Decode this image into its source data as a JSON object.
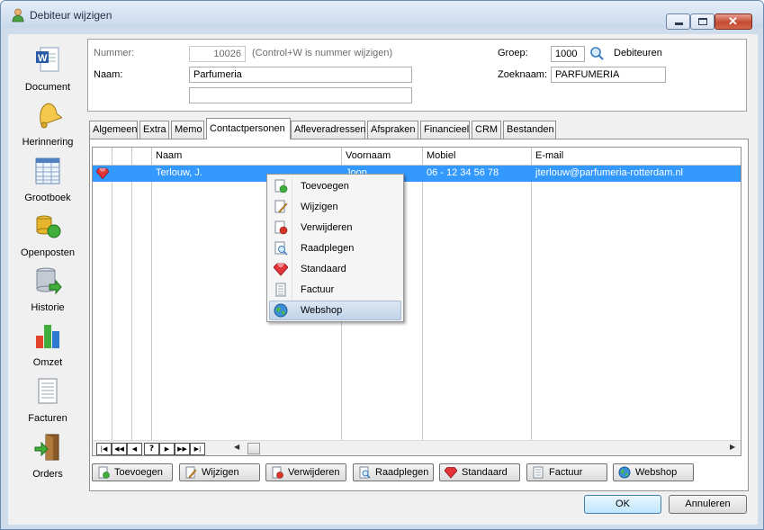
{
  "window": {
    "title": "Debiteur wijzigen"
  },
  "nav": {
    "items": [
      {
        "label": "Document",
        "icon": "word-document-icon"
      },
      {
        "label": "Herinnering",
        "icon": "bell-icon"
      },
      {
        "label": "Grootboek",
        "icon": "ledger-icon"
      },
      {
        "label": "Openposten",
        "icon": "coins-icon"
      },
      {
        "label": "Historie",
        "icon": "database-icon"
      },
      {
        "label": "Omzet",
        "icon": "bar-chart-icon"
      },
      {
        "label": "Facturen",
        "icon": "invoice-icon"
      },
      {
        "label": "Orders",
        "icon": "exit-door-icon"
      }
    ]
  },
  "header": {
    "nummer_label": "Nummer:",
    "nummer_value": "10026",
    "nummer_hint": "(Control+W is nummer wijzigen)",
    "naam_label": "Naam:",
    "naam_value": "Parfumeria",
    "naam2_value": "",
    "groep_label": "Groep:",
    "groep_value": "1000",
    "groep_name": "Debiteuren",
    "zoeknaam_label": "Zoeknaam:",
    "zoeknaam_value": "PARFUMERIA"
  },
  "tabs": [
    "Algemeen",
    "Extra",
    "Memo",
    "Contactpersonen",
    "Afleveradressen",
    "Afspraken",
    "Financieel",
    "CRM",
    "Bestanden"
  ],
  "active_tab": "Contactpersonen",
  "grid": {
    "columns": [
      "Naam",
      "Voornaam",
      "Mobiel",
      "E-mail"
    ],
    "rows": [
      {
        "naam": "Terlouw, J.",
        "voornaam": "Joop",
        "mobiel": "06 - 12 34 56 78",
        "email": "jterlouw@parfumeria-rotterdam.nl",
        "standaard": true
      }
    ],
    "nav_buttons": [
      "|◀",
      "◀◀",
      "◀",
      "?",
      "▶",
      "▶▶",
      "▶|"
    ]
  },
  "context_menu": {
    "items": [
      {
        "label": "Toevoegen",
        "icon": "add-doc-icon"
      },
      {
        "label": "Wijzigen",
        "icon": "edit-pencil-icon"
      },
      {
        "label": "Verwijderen",
        "icon": "delete-doc-icon"
      },
      {
        "label": "Raadplegen",
        "icon": "view-doc-icon"
      },
      {
        "label": "Standaard",
        "icon": "ruby-icon"
      },
      {
        "label": "Factuur",
        "icon": "invoice-icon"
      },
      {
        "label": "Webshop",
        "icon": "globe-icon"
      }
    ],
    "highlighted": "Webshop"
  },
  "actions": {
    "toevoegen": "Toevoegen",
    "wijzigen": "Wijzigen",
    "verwijderen": "Verwijderen",
    "raadplegen": "Raadplegen",
    "standaard": "Standaard",
    "factuur": "Factuur",
    "webshop": "Webshop"
  },
  "dialog": {
    "ok": "OK",
    "cancel": "Annuleren"
  },
  "colors": {
    "selection": "#3399ff",
    "title_bar": "#c8d8ec",
    "close_button": "#c44a32"
  }
}
